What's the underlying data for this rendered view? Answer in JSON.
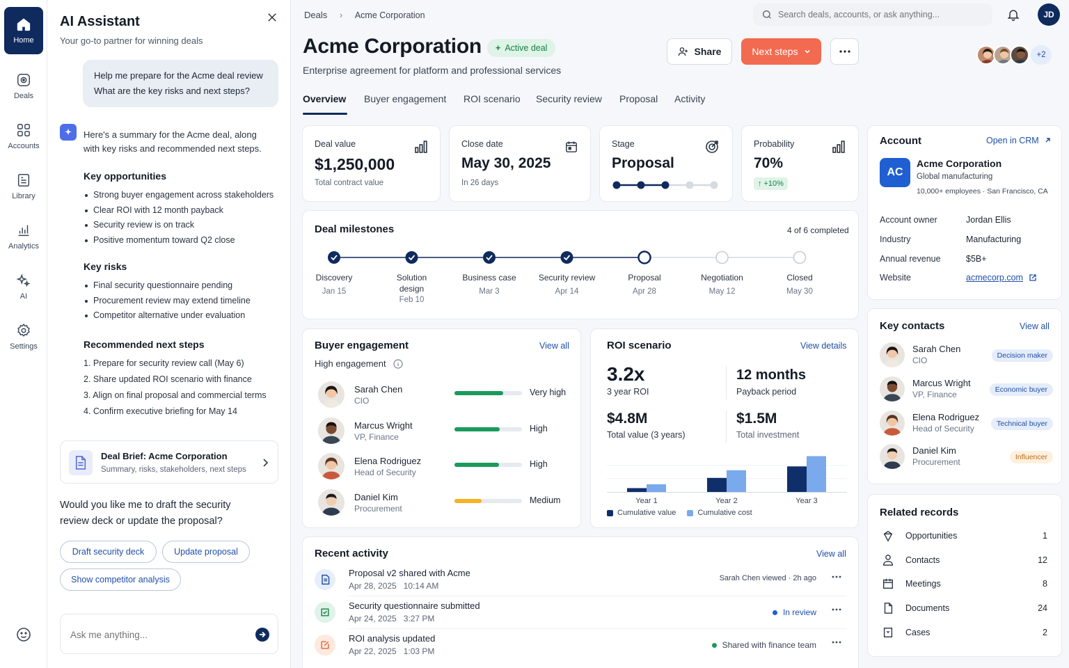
{
  "rail": {
    "items": [
      {
        "label": "Home",
        "icon": "home-icon",
        "active": true
      },
      {
        "label": "Deals",
        "icon": "deals-icon"
      },
      {
        "label": "Accounts",
        "icon": "accounts-icon"
      },
      {
        "label": "Library",
        "icon": "library-icon"
      },
      {
        "label": "Analytics",
        "icon": "analytics-icon"
      },
      {
        "label": "AI",
        "icon": "sparkles-icon"
      },
      {
        "label": "Settings",
        "icon": "gear-icon"
      }
    ]
  },
  "ai": {
    "title": "AI Assistant",
    "subtitle": "Your go-to partner for winning deals",
    "user_msg_1": "Help me prepare for the Acme deal review",
    "user_msg_2": "What are the key risks and next steps?",
    "reply_1": "Here's a summary for the Acme deal, along",
    "reply_2": "with key risks and recommended next steps.",
    "opp_title": "Key opportunities",
    "opps": [
      "Strong buyer engagement across stakeholders",
      "Clear ROI with 12 month payback",
      "Security review is on track",
      "Positive momentum toward Q2 close"
    ],
    "risk_title": "Key risks",
    "risks": [
      "Final security questionnaire pending",
      "Procurement review may extend timeline",
      "Competitor alternative under evaluation"
    ],
    "steps_title": "Recommended next steps",
    "steps": [
      "1.  Prepare for security review call (May 6)",
      "2.  Share updated ROI scenario with finance",
      "3.  Align on final proposal and commercial terms",
      "4.  Confirm executive briefing for May 14"
    ],
    "brief_title": "Deal Brief: Acme Corporation",
    "brief_sub": "Summary, risks, stakeholders, next steps",
    "question_1": "Would you like me to draft the security",
    "question_2": "review deck or update the proposal?",
    "chips": [
      "Draft security deck",
      "Update proposal",
      "Show competitor analysis"
    ],
    "input_placeholder": "Ask me anything..."
  },
  "header": {
    "breadcrumb": [
      "Deals",
      "Acme Corporation"
    ],
    "search_placeholder": "Search deals, accounts, or ask anything...",
    "user_initials": "JD",
    "title": "Acme Corporation",
    "status": "Active deal",
    "subtitle": "Enterprise agreement for platform and professional services",
    "share": "Share",
    "next_steps": "Next steps",
    "more_collab": "+2"
  },
  "tabs": [
    "Overview",
    "Buyer engagement",
    "ROI scenario",
    "Security review",
    "Proposal",
    "Activity"
  ],
  "kpis": {
    "deal_value": {
      "label": "Deal value",
      "value": "$1,250,000",
      "sub": "Total contract value"
    },
    "close_date": {
      "label": "Close date",
      "value": "May 30, 2025",
      "sub": "In 26 days"
    },
    "stage": {
      "label": "Stage",
      "value": "Proposal",
      "completed": 3,
      "total": 5
    },
    "probability": {
      "label": "Probability",
      "value": "70%",
      "delta": "+10%"
    }
  },
  "milestones": {
    "title": "Deal milestones",
    "summary": "4 of 6 completed",
    "items": [
      {
        "name": "Discovery",
        "date": "Jan 15",
        "state": "done"
      },
      {
        "name": "Solution design",
        "date": "Feb 10",
        "state": "done"
      },
      {
        "name": "Business case",
        "date": "Mar 3",
        "state": "done"
      },
      {
        "name": "Security review",
        "date": "Apr 14",
        "state": "done"
      },
      {
        "name": "Proposal",
        "date": "Apr 28",
        "state": "current"
      },
      {
        "name": "Negotiation",
        "date": "May 12",
        "state": "todo"
      },
      {
        "name": "Closed",
        "date": "May 30",
        "state": "todo"
      }
    ]
  },
  "engagement": {
    "title": "Buyer engagement",
    "view_all": "View all",
    "level": "High engagement",
    "people": [
      {
        "name": "Sarah Chen",
        "role": "CIO",
        "level": "Very high",
        "pct": 0.72,
        "color": "#1a9a5c"
      },
      {
        "name": "Marcus Wright",
        "role": "VP, Finance",
        "level": "High",
        "pct": 0.67,
        "color": "#1a9a5c"
      },
      {
        "name": "Elena Rodriguez",
        "role": "Head of Security",
        "level": "High",
        "pct": 0.66,
        "color": "#1a9a5c"
      },
      {
        "name": "Daniel Kim",
        "role": "Procurement",
        "level": "Medium",
        "pct": 0.4,
        "color": "#f5b324"
      }
    ]
  },
  "roi": {
    "title": "ROI scenario",
    "view": "View details",
    "m1": {
      "value": "3.2x",
      "label": "3 year ROI"
    },
    "m2": {
      "value": "12 months",
      "label": "Payback period"
    },
    "m3": {
      "value": "$4.8M",
      "label": "Total value (3 years)"
    },
    "m4": {
      "value": "$1.5M",
      "label": "Total investment"
    }
  },
  "chart_data": {
    "type": "bar",
    "categories": [
      "Year 1",
      "Year 2",
      "Year 3"
    ],
    "series": [
      {
        "name": "Cumulative value",
        "values": [
          0.3,
          1.1,
          2.0
        ],
        "color": "#0f2f6b"
      },
      {
        "name": "Cumulative cost",
        "values": [
          0.6,
          1.7,
          2.8
        ],
        "color": "#7aa9ec"
      }
    ],
    "ylim": [
      0,
      3
    ]
  },
  "activity": {
    "title": "Recent activity",
    "view_all": "View all",
    "items": [
      {
        "title": "Proposal v2 shared with Acme",
        "date": "Apr 28, 2025   10:14 AM",
        "meta": "Sarah Chen viewed · 2h ago",
        "icon": "document-icon",
        "bg": "#e7eefb",
        "fg": "#1f4fa8"
      },
      {
        "title": "Security questionnaire submitted",
        "date": "Apr 24, 2025   3:27 PM",
        "meta": "In review",
        "icon": "checklist-icon",
        "bg": "#dff3e7",
        "fg": "#17804a",
        "dot": "#1f5fd1"
      },
      {
        "title": "ROI analysis updated",
        "date": "Apr 22, 2025   1:03 PM",
        "meta": "Shared with finance team",
        "icon": "edit-icon",
        "bg": "#fde9df",
        "fg": "#e06a37",
        "dot": "#1a9a5c"
      }
    ]
  },
  "account": {
    "title": "Account",
    "open_crm": "Open in CRM",
    "initials": "AC",
    "name": "Acme Corporation",
    "industry_line": "Global manufacturing",
    "meta_line": "10,000+ employees · San Francisco, CA",
    "fields": [
      {
        "k": "Account owner",
        "v": "Jordan Ellis"
      },
      {
        "k": "Industry",
        "v": "Manufacturing"
      },
      {
        "k": "Annual revenue",
        "v": "$5B+"
      },
      {
        "k": "Website",
        "v": "acmecorp.com"
      }
    ]
  },
  "contacts": {
    "title": "Key contacts",
    "view_all": "View all",
    "items": [
      {
        "name": "Sarah Chen",
        "role": "CIO",
        "badge": "Decision maker",
        "bg": "#e5ecfa",
        "fg": "#1f4fa8"
      },
      {
        "name": "Marcus Wright",
        "role": "VP, Finance",
        "badge": "Economic buyer",
        "bg": "#e5ecfa",
        "fg": "#1f4fa8"
      },
      {
        "name": "Elena Rodriguez",
        "role": "Head of Security",
        "badge": "Technical buyer",
        "bg": "#e5ecfa",
        "fg": "#1f4fa8"
      },
      {
        "name": "Daniel Kim",
        "role": "Procurement",
        "badge": "Influencer",
        "bg": "#fdf0df",
        "fg": "#c46a12"
      }
    ]
  },
  "related": {
    "title": "Related records",
    "items": [
      {
        "label": "Opportunities",
        "count": "1",
        "icon": "opportunity-icon"
      },
      {
        "label": "Contacts",
        "count": "12",
        "icon": "person-icon"
      },
      {
        "label": "Meetings",
        "count": "8",
        "icon": "calendar-icon"
      },
      {
        "label": "Documents",
        "count": "24",
        "icon": "file-icon"
      },
      {
        "label": "Cases",
        "count": "2",
        "icon": "case-icon"
      }
    ]
  }
}
